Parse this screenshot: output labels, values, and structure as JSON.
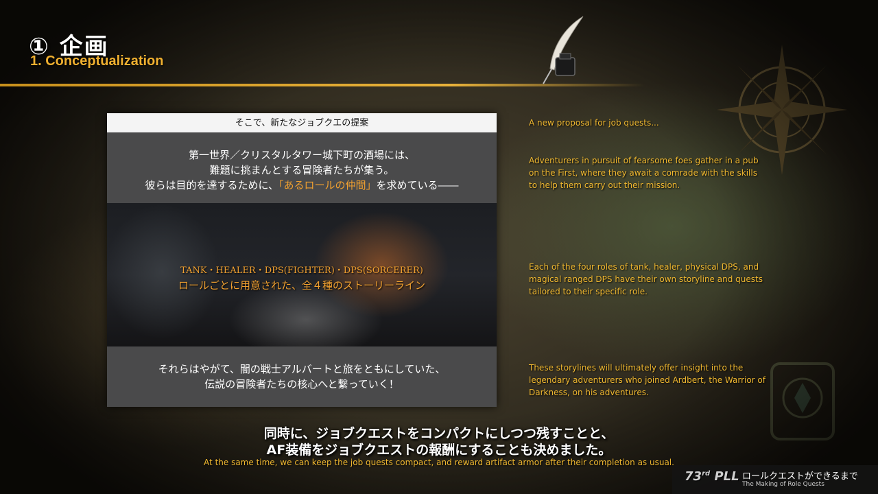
{
  "header": {
    "title": "① 企画",
    "subtitle": "1. Conceptualization"
  },
  "slide": {
    "header": "そこで、新たなジョブクエの提案",
    "lead_line1": "第一世界／クリスタルタワー城下町の酒場には、",
    "lead_line2": "難題に挑まんとする冒険者たちが集う。",
    "lead_line3_pre": "彼らは目的を達するために、",
    "lead_line3_highlight": "「あるロールの仲間」",
    "lead_line3_post": "を求めている――",
    "roles_line1": "TANK・HEALER・DPS(FIGHTER)・DPS(SORCERER)",
    "roles_line2": "ロールごとに用意された、全４種のストーリーライン",
    "finale_line1": "それらはやがて、闇の戦士アルバートと旅をともにしていた、",
    "finale_line2": "伝説の冒険者たちの核心へと繋っていく！"
  },
  "notes": {
    "note1": "A new proposal for job quests...",
    "note2": "Adventurers in pursuit of fearsome foes gather in a pub on the First, where they await a comrade with the skills to help them carry out their mission.",
    "note3": "Each of the four roles of tank, healer, physical DPS, and magical ranged DPS have their own storyline and quests tailored to their specific role.",
    "note4": "These storylines will ultimately offer insight into the legendary adventurers who joined Ardbert, the Warrior of Darkness, on his adventures."
  },
  "subtitle": {
    "line1": "同時に、ジョブクエストをコンパクトにしつつ残すことと、",
    "line2": "AF装備をジョブクエストの報酬にすることも決めました。",
    "english": "At the same time, we can keep the job quests compact, and reward artifact armor after their completion as usual."
  },
  "footer": {
    "number": "73",
    "suffix": "rd",
    "label": "PLL",
    "title_jp": "ロールクエストができるまで",
    "title_en": "The Making of Role Quests"
  }
}
